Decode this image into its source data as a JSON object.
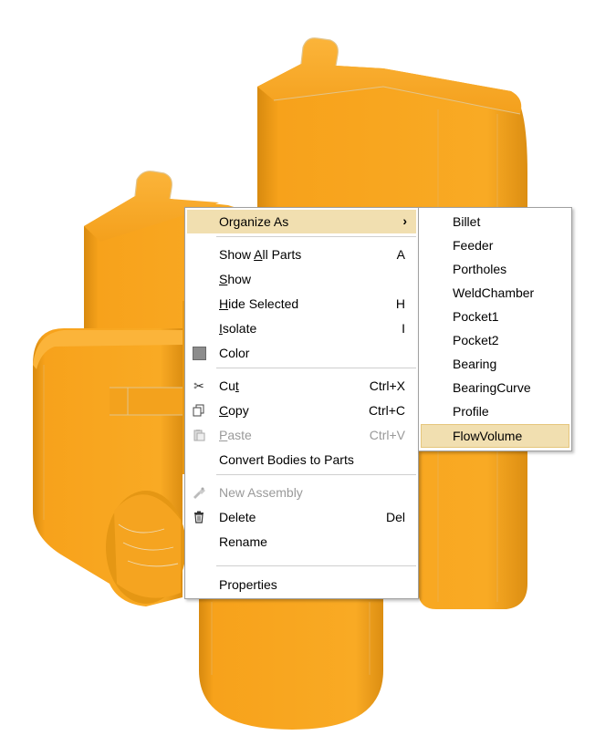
{
  "colors": {
    "part_base": "#f7a21b",
    "part_light": "#fbb43a",
    "part_dark": "#d88a0f",
    "part_edge": "#e2c48a",
    "menu_highlight": "#f1dfb0",
    "color_swatch": "#8c8c8c"
  },
  "context_menu": {
    "organize_as": "Organize As",
    "show_all_parts": {
      "pre": "Show ",
      "key": "A",
      "post": "ll Parts",
      "shortcut": "A"
    },
    "show": {
      "key": "S",
      "post": "how"
    },
    "hide_selected": {
      "key": "H",
      "post": "ide Selected",
      "shortcut": "H"
    },
    "isolate": {
      "key": "I",
      "post": "solate",
      "shortcut": "I"
    },
    "color": "Color",
    "cut": {
      "pre": "Cu",
      "key": "t",
      "shortcut": "Ctrl+X"
    },
    "copy": {
      "key": "C",
      "post": "opy",
      "shortcut": "Ctrl+C"
    },
    "paste": {
      "key": "P",
      "post": "aste",
      "shortcut": "Ctrl+V"
    },
    "convert_bodies": "Convert Bodies to Parts",
    "new_assembly": "New Assembly",
    "delete": {
      "label": "Delete",
      "shortcut": "Del"
    },
    "rename": "Rename",
    "properties": "Properties"
  },
  "icons": {
    "submenu_arrow": "chevron-right-icon",
    "color": "color-swatch-icon",
    "cut": "scissors-icon",
    "copy": "copy-icon",
    "paste": "clipboard-icon",
    "new_assembly": "new-assembly-icon",
    "delete": "trash-icon"
  },
  "submenu": {
    "items": [
      "Billet",
      "Feeder",
      "Portholes",
      "WeldChamber",
      "Pocket1",
      "Pocket2",
      "Bearing",
      "BearingCurve",
      "Profile",
      "FlowVolume"
    ],
    "selected": "FlowVolume"
  }
}
